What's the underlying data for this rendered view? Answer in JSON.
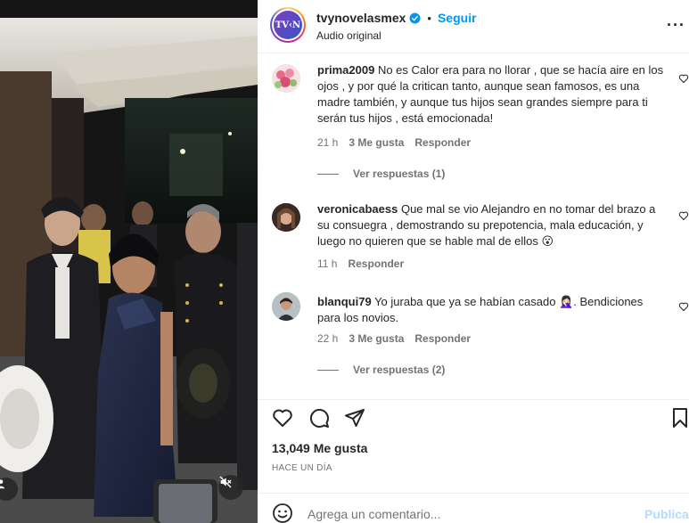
{
  "account": {
    "username": "tvynovelasmex",
    "logo_text": "TV‹N",
    "follow_label": "Seguir",
    "separator": "•",
    "audio_label": "Audio original",
    "more_label": "···"
  },
  "comments": [
    {
      "username": "prima2009",
      "text": "No es Calor era para no llorar , que se hacía aire en los ojos , y por qué la critican tanto, aunque sean famosos, es una madre también, y aunque tus hijos sean grandes siempre para ti serán tus hijos , está emocionada!",
      "time": "21 h",
      "likes": "3 Me gusta",
      "reply_label": "Responder",
      "view_replies": "Ver respuestas (1)"
    },
    {
      "username": "veronicabaess",
      "text": "Que mal se vio Alejandro en no tomar del brazo a su consuegra , demostrando su prepotencia, mala educación, y luego no quieren que se hable mal de ellos 😮",
      "time": "11 h",
      "reply_label": "Responder"
    },
    {
      "username": "blanqui79",
      "text": "Yo juraba que ya se habían casado 🤦🏻‍♀️. Bendiciones para los novios.",
      "time": "22 h",
      "likes": "3 Me gusta",
      "reply_label": "Responder",
      "view_replies": "Ver respuestas (2)"
    }
  ],
  "post": {
    "likes": "13,049 Me gusta",
    "timestamp": "HACE UN DÍA"
  },
  "composer": {
    "placeholder": "Agrega un comentario...",
    "publish_label": "Publicar"
  },
  "icons": {
    "like": "heart-icon",
    "comment": "comment-icon",
    "share": "share-icon",
    "save": "bookmark-icon",
    "emoji": "emoji-icon",
    "mute": "mute-icon",
    "tag": "user-tag-icon",
    "verified": "verified-badge-icon"
  },
  "colors": {
    "accent": "#0095f6",
    "publish_disabled": "#b3dbff",
    "secondary_text": "#737373"
  }
}
